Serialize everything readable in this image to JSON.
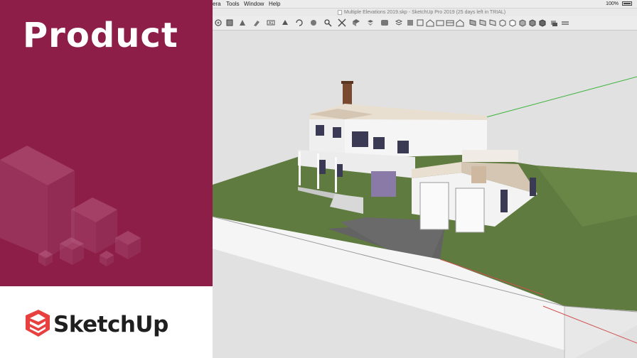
{
  "promo": {
    "title": "Product",
    "brand_name": "SketchUp",
    "panel_color": "#8c1e48",
    "logo_color": "#e8403e"
  },
  "menubar": {
    "items": [
      "era",
      "Tools",
      "Window",
      "Help"
    ],
    "zoom": "100%",
    "battery_icon": "battery-icon"
  },
  "window": {
    "title": "Multiple Elevations 2019.skp - SketchUp Pro 2019 (25 days left in TRIAL)"
  },
  "toolbar": {
    "tools": [
      "orbit-icon",
      "select-icon",
      "paint-bucket-icon",
      "eraser-icon",
      "text-icon",
      "pushpull-icon",
      "rotate-icon",
      "move-icon",
      "zoom-icon",
      "zoom-extents-icon",
      "warehouse-icon",
      "components-icon",
      "styles-icon",
      "layers-icon",
      "iso-view-icon",
      "top-view-icon",
      "front-view-icon",
      "right-view-icon",
      "back-view-icon",
      "left-view-icon",
      "section-plane-icon",
      "section-display-icon",
      "xray-icon",
      "wireframe-icon",
      "hidden-line-icon",
      "shaded-icon",
      "textured-icon",
      "monochrome-icon",
      "shadows-icon",
      "fog-icon"
    ]
  }
}
